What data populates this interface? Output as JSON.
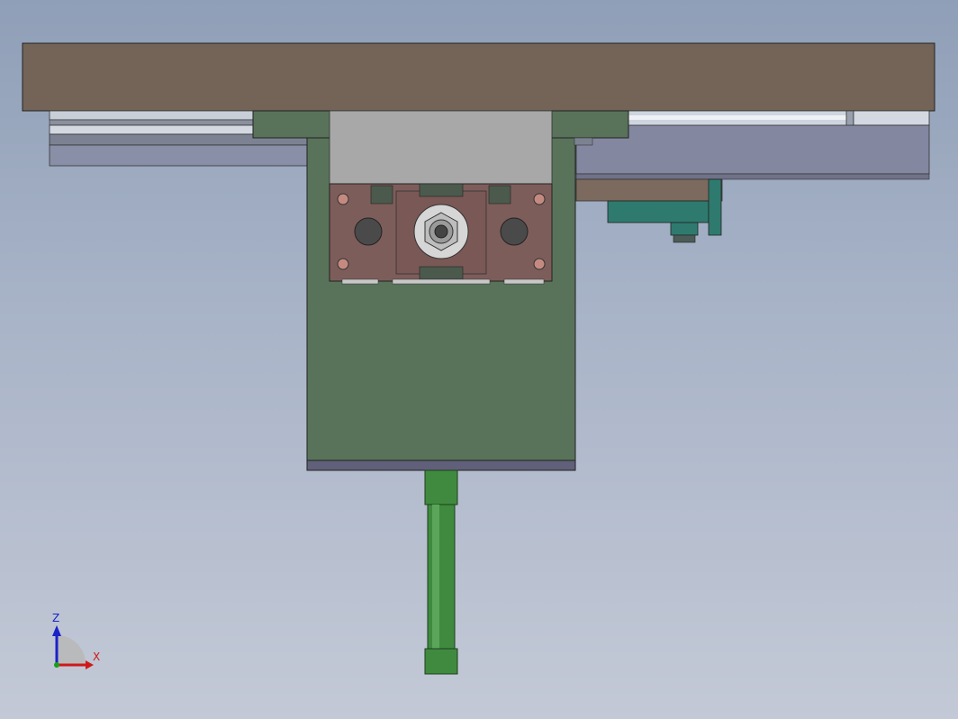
{
  "viewport": {
    "background_top": "#8f9fb7",
    "background_bottom": "#c3c9d6"
  },
  "model": {
    "colors": {
      "base_plate": "#736457",
      "bracket": "#58735a",
      "bracket_dark": "#3f5641",
      "rail": "#c7cdd8",
      "rail_shadow": "#7a7f8c",
      "carriage_block": "#7d5d5a",
      "cover_gray": "#a6a6a6",
      "motor_teal": "#2f7a6e",
      "rod_green": "#3f8a3f",
      "foot_plate": "#60607a"
    }
  },
  "triad": {
    "z_label": "Z",
    "x_label": "X",
    "z_color": "#1a22c8",
    "x_color": "#d01818",
    "y_color": "#18a018"
  }
}
